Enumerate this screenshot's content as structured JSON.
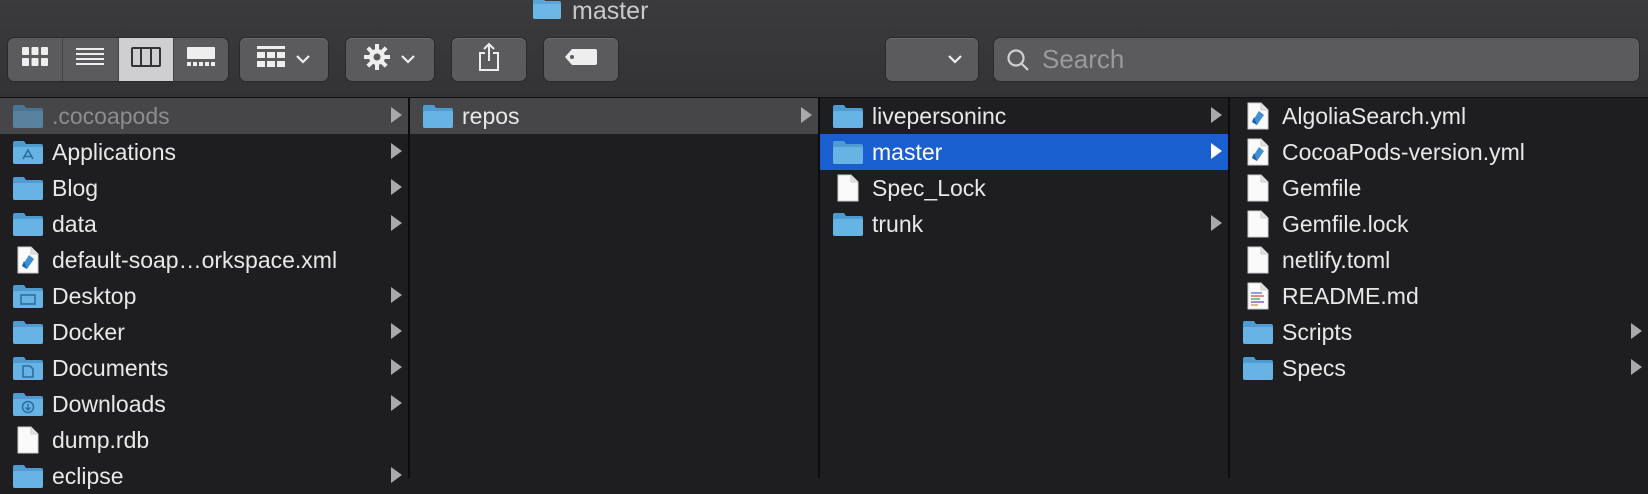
{
  "window": {
    "title": "master"
  },
  "toolbar": {
    "view_modes": [
      {
        "icon": "icon-view-icon"
      },
      {
        "icon": "list-view-icon"
      },
      {
        "icon": "column-view-icon",
        "active": true
      },
      {
        "icon": "gallery-view-icon"
      }
    ],
    "search_placeholder": "Search"
  },
  "columns": [
    {
      "items": [
        {
          "name": ".cocoapods",
          "type": "folder",
          "has_children": true,
          "state": "selected-inactive",
          "dim": true
        },
        {
          "name": "Applications",
          "type": "folder-apps",
          "has_children": true
        },
        {
          "name": "Blog",
          "type": "folder",
          "has_children": true
        },
        {
          "name": "data",
          "type": "folder",
          "has_children": true
        },
        {
          "name": "default-soap…orkspace.xml",
          "type": "xml-file",
          "has_children": false
        },
        {
          "name": "Desktop",
          "type": "folder-desktop",
          "has_children": true
        },
        {
          "name": "Docker",
          "type": "folder",
          "has_children": true
        },
        {
          "name": "Documents",
          "type": "folder-docs",
          "has_children": true
        },
        {
          "name": "Downloads",
          "type": "folder-downloads",
          "has_children": true
        },
        {
          "name": "dump.rdb",
          "type": "file",
          "has_children": false
        },
        {
          "name": "eclipse",
          "type": "folder",
          "has_children": true
        }
      ]
    },
    {
      "items": [
        {
          "name": "repos",
          "type": "folder",
          "has_children": true,
          "state": "selected-inactive"
        }
      ]
    },
    {
      "items": [
        {
          "name": "livepersoninc",
          "type": "folder",
          "has_children": true
        },
        {
          "name": "master",
          "type": "folder",
          "has_children": true,
          "state": "selected"
        },
        {
          "name": "Spec_Lock",
          "type": "file",
          "has_children": false
        },
        {
          "name": "trunk",
          "type": "folder",
          "has_children": true
        }
      ]
    },
    {
      "items": [
        {
          "name": "AlgoliaSearch.yml",
          "type": "xml-file",
          "has_children": false
        },
        {
          "name": "CocoaPods-version.yml",
          "type": "xml-file",
          "has_children": false
        },
        {
          "name": "Gemfile",
          "type": "file",
          "has_children": false
        },
        {
          "name": "Gemfile.lock",
          "type": "file",
          "has_children": false
        },
        {
          "name": "netlify.toml",
          "type": "file",
          "has_children": false
        },
        {
          "name": "README.md",
          "type": "text-file",
          "has_children": false
        },
        {
          "name": "Scripts",
          "type": "folder",
          "has_children": true
        },
        {
          "name": "Specs",
          "type": "folder",
          "has_children": true
        }
      ]
    }
  ],
  "colors": {
    "selection_blue": "#1a5fd0",
    "folder_blue": "#5aa6d8",
    "toolbar_bg": "#3b3b3e",
    "pane_bg": "#1e1e20"
  }
}
